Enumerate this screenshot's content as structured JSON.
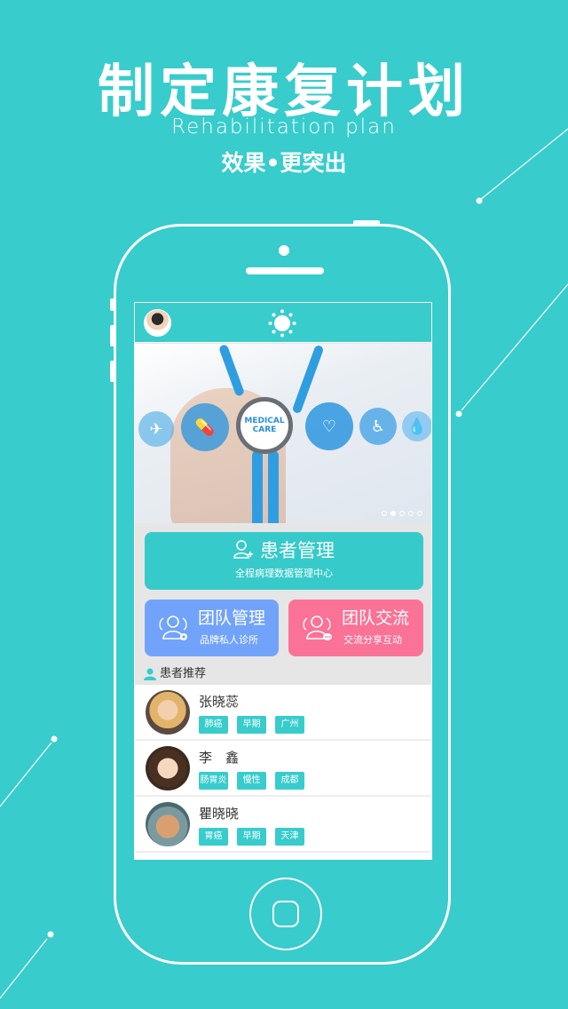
{
  "hero": {
    "title": "制定康复计划",
    "subtitle": "Rehabilitation plan",
    "tagline": "效果•更突出"
  },
  "colors": {
    "background": "#38cccc",
    "patient_tile": "#37caca",
    "team_tile": "#72a3fa",
    "comm_tile": "#fb7297",
    "tag": "#38cccc"
  },
  "appbar": {
    "avatar_icon": "doctor-avatar",
    "center_icon": "sun-icon"
  },
  "banner": {
    "badge_line1": "MEDICAL",
    "badge_line2": "CARE",
    "icons": [
      "world-map-icon",
      "pill-icon",
      "heartbeat-icon",
      "wheelchair-icon",
      "water-drop-icon"
    ],
    "slide_count": 5,
    "active_slide": 2
  },
  "tiles": {
    "patient": {
      "title": "患者管理",
      "subtitle": "全程病理数据管理中心",
      "icon": "add-user-icon"
    },
    "team": {
      "title": "团队管理",
      "subtitle": "品牌私人诊所",
      "icon": "team-settings-icon"
    },
    "comm": {
      "title": "团队交流",
      "subtitle": "交流分享互动",
      "icon": "team-chat-icon"
    }
  },
  "section": {
    "title": "患者推荐",
    "icon": "person-icon"
  },
  "patients": [
    {
      "name": "张晓蕊",
      "tags": [
        "肺癌",
        "早期",
        "广州"
      ]
    },
    {
      "name": "李　鑫",
      "tags": [
        "肠胃炎",
        "慢性",
        "成都"
      ]
    },
    {
      "name": "瞿晓晓",
      "tags": [
        "胃癌",
        "早期",
        "天津"
      ]
    }
  ]
}
